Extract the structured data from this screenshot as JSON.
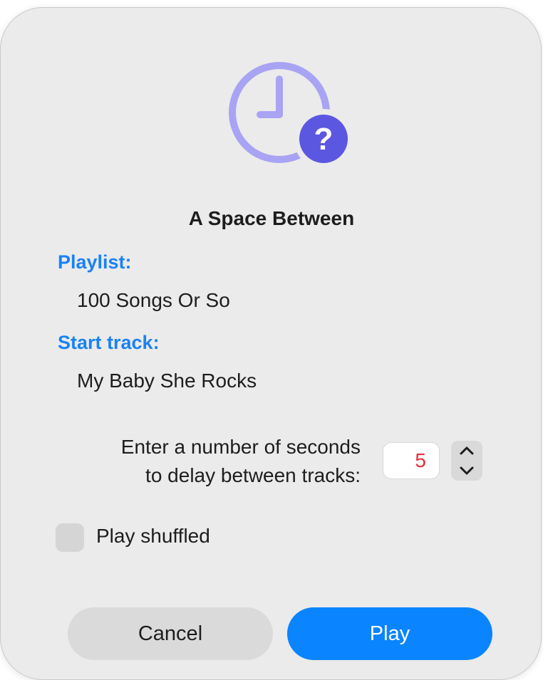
{
  "dialog": {
    "icon": "clock-question-icon",
    "title": "A Space Between",
    "playlist_label": "Playlist:",
    "playlist_value": "100 Songs Or So",
    "start_track_label": "Start track:",
    "start_track_value": "My Baby She Rocks",
    "delay_label_line1": "Enter a number of seconds",
    "delay_label_line2": "to delay between tracks:",
    "delay_value": "5",
    "shuffle_label": "Play shuffled",
    "shuffle_checked": false,
    "cancel_label": "Cancel",
    "play_label": "Play"
  },
  "colors": {
    "accent": "#0a84ff",
    "label_blue": "#1a82f5",
    "icon_purple": "#a9a3f4",
    "icon_badge": "#5c57e0",
    "delay_value_red": "#e5303a"
  }
}
